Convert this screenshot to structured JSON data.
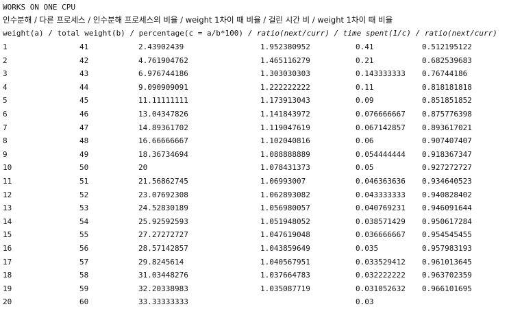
{
  "title": "WORKS ON ONE CPU",
  "header_ko": "인수분해   / 다른 프로세스    /  인수분해 프로세스의 비율 / weight 1차이 때 비율 /  걸린 시간 비 /  weight 1차이 때 비율",
  "header_en": {
    "part1": "weight(a) / total weight(b) / percentage(c = a/b*100) / ",
    "part2_italic": "ratio(next/curr) / time spent(1/c) / ratio(next/curr)"
  },
  "rows": [
    [
      "1",
      "41",
      "2.43902439",
      "1.952380952",
      "0.41",
      "0.512195122"
    ],
    [
      "2",
      "42",
      "4.761904762",
      "1.465116279",
      "0.21",
      "0.682539683"
    ],
    [
      "3",
      "43",
      "6.976744186",
      "1.303030303",
      "0.143333333",
      "0.76744186"
    ],
    [
      "4",
      "44",
      "9.090909091",
      "1.222222222",
      "0.11",
      "0.818181818"
    ],
    [
      "5",
      "45",
      "11.11111111",
      "1.173913043",
      "0.09",
      "0.851851852"
    ],
    [
      "6",
      "46",
      "13.04347826",
      "1.141843972",
      "0.076666667",
      "0.875776398"
    ],
    [
      "7",
      "47",
      "14.89361702",
      "1.119047619",
      "0.067142857",
      "0.893617021"
    ],
    [
      "8",
      "48",
      "16.66666667",
      "1.102040816",
      "0.06",
      "0.907407407"
    ],
    [
      "9",
      "49",
      "18.36734694",
      "1.088888889",
      "0.054444444",
      "0.918367347"
    ],
    [
      "10",
      "50",
      "20",
      "1.078431373",
      "0.05",
      "0.927272727"
    ],
    [
      "11",
      "51",
      "21.56862745",
      "1.06993007",
      "0.046363636",
      "0.934640523"
    ],
    [
      "12",
      "52",
      "23.07692308",
      "1.062893082",
      "0.043333333",
      "0.940828402"
    ],
    [
      "13",
      "53",
      "24.52830189",
      "1.056980057",
      "0.040769231",
      "0.946091644"
    ],
    [
      "14",
      "54",
      "25.92592593",
      "1.051948052",
      "0.038571429",
      "0.950617284"
    ],
    [
      "15",
      "55",
      "27.27272727",
      "1.047619048",
      "0.036666667",
      "0.954545455"
    ],
    [
      "16",
      "56",
      "28.57142857",
      "1.043859649",
      "0.035",
      "0.957983193"
    ],
    [
      "17",
      "57",
      "29.8245614",
      "1.040567951",
      "0.033529412",
      "0.961013645"
    ],
    [
      "18",
      "58",
      "31.03448276",
      "1.037664783",
      "0.032222222",
      "0.963702359"
    ],
    [
      "19",
      "59",
      "32.20338983",
      "1.035087719",
      "0.031052632",
      "0.966101695"
    ],
    [
      "20",
      "60",
      "33.33333333",
      "",
      "0.03",
      ""
    ]
  ]
}
